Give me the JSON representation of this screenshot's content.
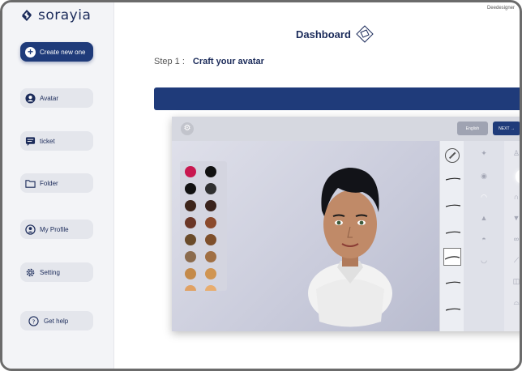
{
  "brand": {
    "name": "sorayia"
  },
  "corner_label": "Deedesigner",
  "sidebar": {
    "create_label": "Create new one",
    "items": [
      {
        "label": "Avatar",
        "icon": "user-circle-icon"
      },
      {
        "label": "ticket",
        "icon": "chat-icon"
      },
      {
        "label": "Folder",
        "icon": "folder-icon"
      },
      {
        "label": "My Profile",
        "icon": "profile-icon"
      },
      {
        "label": "Setting",
        "icon": "gear-icon"
      },
      {
        "label": "Get help",
        "icon": "help-icon"
      }
    ]
  },
  "header": {
    "title": "Dashboard"
  },
  "step": {
    "prefix": "Step 1 :",
    "title": "Craft your avatar"
  },
  "editor": {
    "language_label": "English",
    "next_label": "NEXT →"
  },
  "colors": {
    "navy": "#1f3b7a",
    "swatches": [
      "#c8174f",
      "#111111",
      "#111111",
      "#2f2f2f",
      "#3d2419",
      "#3a231c",
      "#6a3626",
      "#8b4a2c",
      "#6a4b2a",
      "#7e4f2b",
      "#8b6b4d",
      "#a06f43",
      "#c48a4a",
      "#d09552",
      "#e0a164",
      "#e8ad6f"
    ]
  }
}
